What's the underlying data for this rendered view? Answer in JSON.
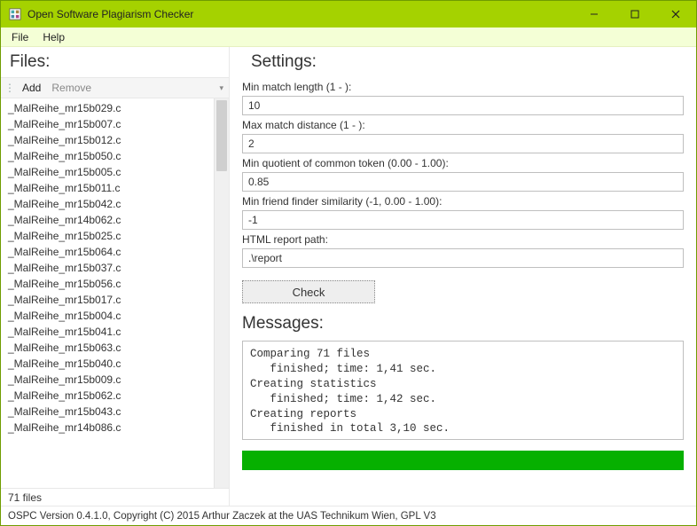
{
  "window": {
    "title": "Open Software Plagiarism Checker",
    "minimize": "–",
    "maximize": "□",
    "close": "✕"
  },
  "menu": {
    "file": "File",
    "help": "Help"
  },
  "left": {
    "heading": "Files:",
    "add": "Add",
    "remove": "Remove",
    "dropdown": "▾",
    "status": "71 files",
    "files": [
      "_MalReihe_mr15b029.c",
      "_MalReihe_mr15b007.c",
      "_MalReihe_mr15b012.c",
      "_MalReihe_mr15b050.c",
      "_MalReihe_mr15b005.c",
      "_MalReihe_mr15b011.c",
      "_MalReihe_mr15b042.c",
      "_MalReihe_mr14b062.c",
      "_MalReihe_mr15b025.c",
      "_MalReihe_mr15b064.c",
      "_MalReihe_mr15b037.c",
      "_MalReihe_mr15b056.c",
      "_MalReihe_mr15b017.c",
      "_MalReihe_mr15b004.c",
      "_MalReihe_mr15b041.c",
      "_MalReihe_mr15b063.c",
      "_MalReihe_mr15b040.c",
      "_MalReihe_mr15b009.c",
      "_MalReihe_mr15b062.c",
      "_MalReihe_mr15b043.c",
      "_MalReihe_mr14b086.c"
    ]
  },
  "settings": {
    "heading": "Settings:",
    "minMatch": {
      "label": "Min match length (1 - ):",
      "value": "10"
    },
    "maxDist": {
      "label": "Max match distance (1 - ):",
      "value": "2"
    },
    "minQuot": {
      "label": "Min quotient of common token (0.00 - 1.00):",
      "value": "0.85"
    },
    "minFriend": {
      "label": "Min friend finder similarity (-1, 0.00 - 1.00):",
      "value": "-1"
    },
    "reportPath": {
      "label": "HTML report path:",
      "value": ".\\report"
    },
    "check": "Check"
  },
  "messages": {
    "heading": "Messages:",
    "text": "Comparing 71 files\n   finished; time: 1,41 sec.\nCreating statistics\n   finished; time: 1,42 sec.\nCreating reports\n   finished in total 3,10 sec."
  },
  "footer": "OSPC Version 0.4.1.0, Copyright (C) 2015 Arthur Zaczek at the UAS Technikum Wien, GPL V3"
}
